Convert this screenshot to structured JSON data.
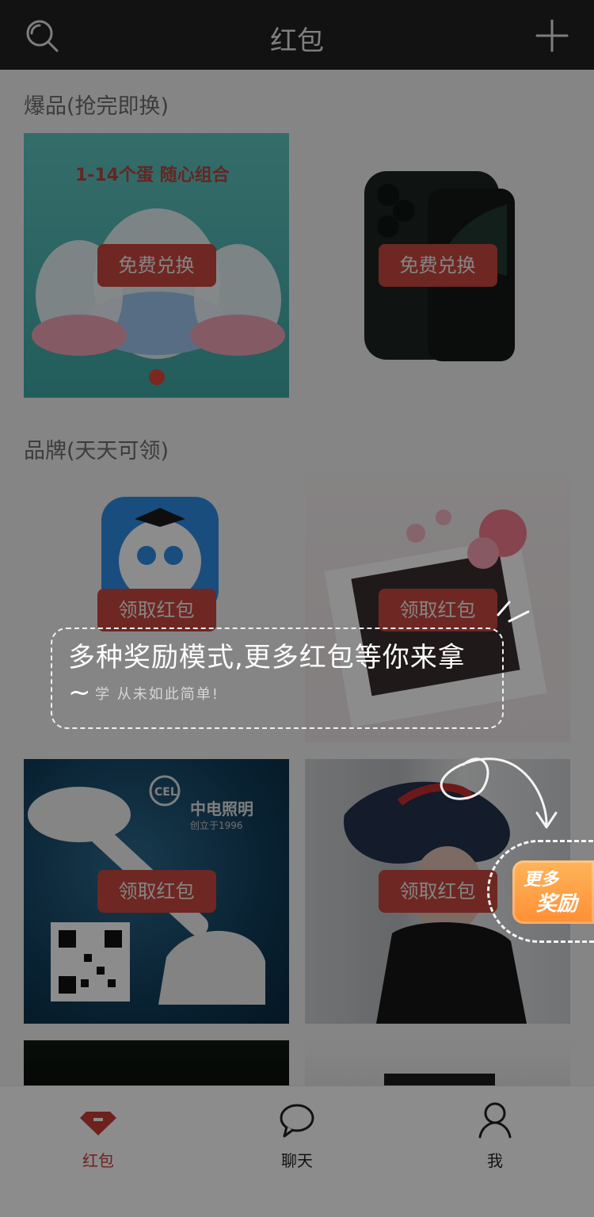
{
  "header": {
    "title": "红包",
    "icons": [
      "search-icon",
      "plus-icon"
    ]
  },
  "sections": [
    {
      "title": "爆品(抢完即换)",
      "cards": [
        {
          "image_text": "1-14个蛋 随心组合",
          "cta": "免费兑换"
        },
        {
          "image_text": "",
          "cta": "免费兑换"
        }
      ]
    },
    {
      "title": "品牌(天天可领)",
      "cards": [
        {
          "image_text": "",
          "cta": "领取红包"
        },
        {
          "image_text": "",
          "cta": "领取红包"
        },
        {
          "image_text": "中电照明",
          "image_text2": "创立于1996",
          "image_brand": "CEL",
          "cta": "领取红包"
        },
        {
          "image_text": "",
          "cta": "领取红包"
        }
      ]
    }
  ],
  "tooltip": {
    "text": "多种奖励模式,更多红包等你来拿~",
    "partial_under_text": "学 从未如此简单!"
  },
  "more_rewards": {
    "line1": "更多",
    "line2": "奖励"
  },
  "tabbar": {
    "items": [
      {
        "label": "红包",
        "icon": "diamond-icon",
        "active": true
      },
      {
        "label": "聊天",
        "icon": "chat-bubble-icon",
        "active": false
      },
      {
        "label": "我",
        "icon": "person-icon",
        "active": false
      }
    ]
  },
  "colors": {
    "accent": "#c83d36",
    "header_bg": "#222222",
    "cta_bg": "#c9473f"
  }
}
